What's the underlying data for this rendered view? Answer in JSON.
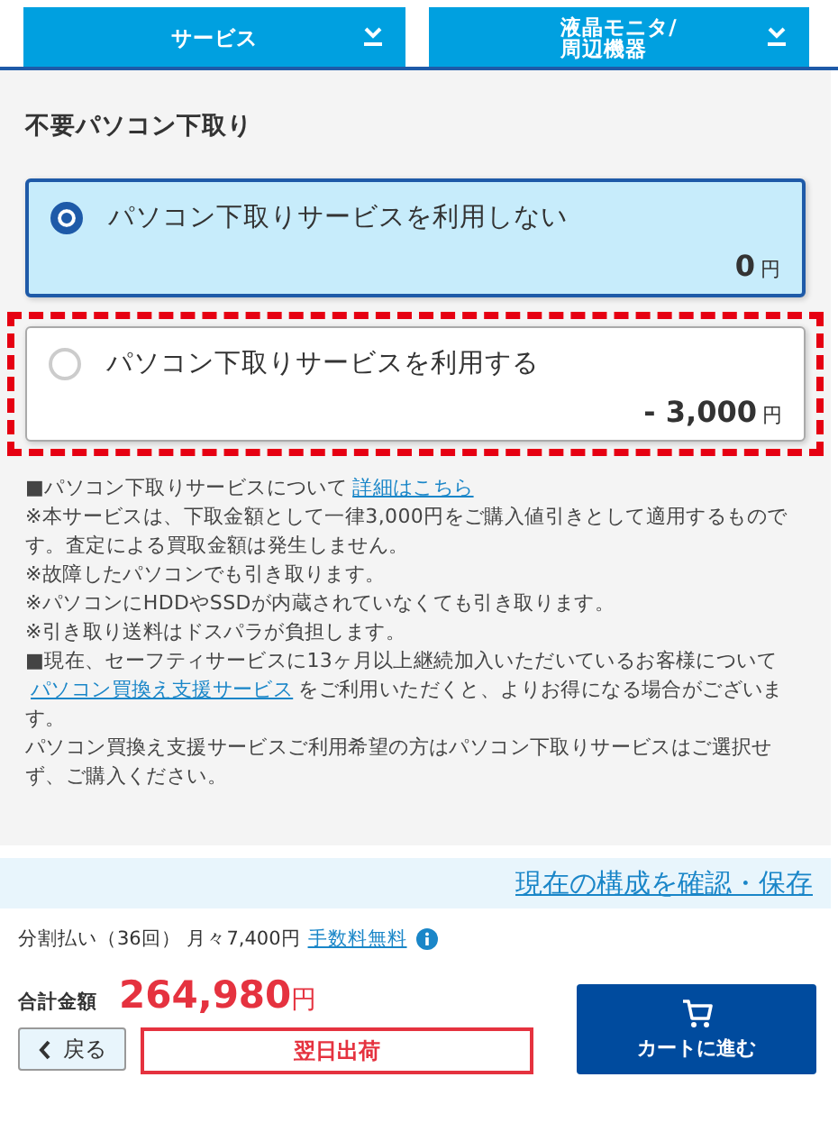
{
  "tabs": [
    {
      "label": "サービス"
    },
    {
      "label": "液晶モニタ/\n周辺機器"
    }
  ],
  "section": {
    "title": "不要パソコン下取り",
    "options": [
      {
        "label": "パソコン下取りサービスを利用しない",
        "price": "0",
        "unit": "円",
        "selected": true,
        "highlighted": false
      },
      {
        "label": "パソコン下取りサービスを利用する",
        "price": "- 3,000",
        "unit": "円",
        "selected": false,
        "highlighted": true
      }
    ],
    "notes": [
      {
        "text": "■パソコン下取りサービスについて",
        "link": "詳細はこちら"
      },
      {
        "text": "※本サービスは、下取金額として一律3,000円をご購入値引きとして適用するものです。査定による買取金額は発生しません。"
      },
      {
        "text": "※故障したパソコンでも引き取ります。"
      },
      {
        "text": "※パソコンにHDDやSSDが内蔵されていなくても引き取ります。"
      },
      {
        "text": "※引き取り送料はドスパラが負担します。"
      },
      {
        "text": "■現在、セーフティサービスに13ヶ月以上継続加入いただいているお客様について"
      },
      {
        "link": "パソコン買換え支援サービス",
        "text_after": "をご利用いただくと、よりお得になる場合がございます。"
      },
      {
        "text": "パソコン買換え支援サービスご利用希望の方はパソコン下取りサービスはご選択せず、ご購入ください。"
      }
    ]
  },
  "footer": {
    "config_link": "現在の構成を確認・保存",
    "installment": "分割払い（36回） 月々7,400円",
    "fee_link": "手数料無料",
    "total_label": "合計金額",
    "total": "264,980",
    "total_unit": "円",
    "back": "戻る",
    "shipping": "翌日出荷",
    "cart": "カートに進む"
  }
}
